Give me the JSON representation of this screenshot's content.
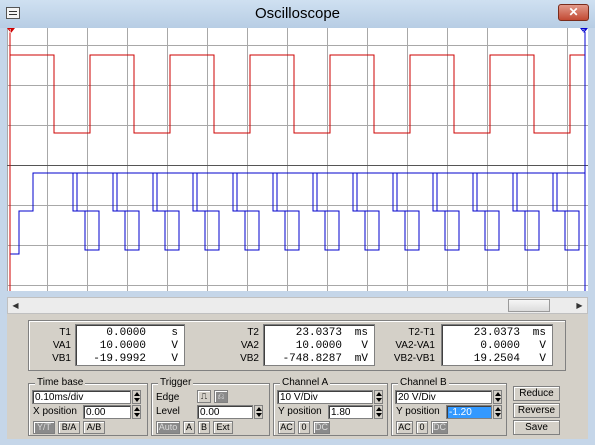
{
  "window": {
    "title": "Oscilloscope"
  },
  "cursors": {
    "t1_marker": "1",
    "t2_marker": "2"
  },
  "scope": {
    "divisions": {
      "x": 14.5,
      "y": 6.575
    },
    "timebase_ms_per_div": 0.1,
    "channel_a": {
      "color": "#cc0000",
      "volts_per_div": 10,
      "period_ms": 0.2,
      "duty": 0.55,
      "high_div": -1.96,
      "low_div": 0.0
    },
    "channel_b": {
      "color": "#0000cc",
      "volts_per_div": 20,
      "period_ms": 0.2,
      "levels_div": [
        0.95,
        -0.95,
        0.7
      ]
    }
  },
  "readouts": {
    "col1": [
      {
        "label": "T1",
        "value": "0.0000",
        "unit": "s"
      },
      {
        "label": "VA1",
        "value": "10.0000",
        "unit": "V"
      },
      {
        "label": "VB1",
        "value": "-19.9992",
        "unit": "V"
      }
    ],
    "col2": [
      {
        "label": "T2",
        "value": "23.0373",
        "unit": "ms"
      },
      {
        "label": "VA2",
        "value": "10.0000",
        "unit": "V"
      },
      {
        "label": "VB2",
        "value": "-748.8287",
        "unit": "mV"
      }
    ],
    "col3": [
      {
        "label": "T2-T1",
        "value": "23.0373",
        "unit": "ms"
      },
      {
        "label": "VA2-VA1",
        "value": "0.0000",
        "unit": "V"
      },
      {
        "label": "VB2-VB1",
        "value": "19.2504",
        "unit": "V"
      }
    ]
  },
  "timebase": {
    "title": "Time base",
    "scale": "0.10ms/div",
    "xpos_label": "X position",
    "xpos": "0.00",
    "modes": [
      "Y/T",
      "B/A",
      "A/B"
    ]
  },
  "trigger": {
    "title": "Trigger",
    "edge_label": "Edge",
    "level_label": "Level",
    "level": "0.00",
    "sources": [
      "Auto",
      "A",
      "B",
      "Ext"
    ]
  },
  "channel_a_ctrl": {
    "title": "Channel A",
    "scale": "10 V/Div",
    "ypos_label": "Y position",
    "ypos": "1.80",
    "coupling": [
      "AC",
      "0",
      "DC"
    ]
  },
  "channel_b_ctrl": {
    "title": "Channel B",
    "scale": "20 V/Div",
    "ypos_label": "Y position",
    "ypos": "-1.20",
    "coupling": [
      "AC",
      "0",
      "DC"
    ]
  },
  "actions": {
    "reduce": "Reduce",
    "reverse": "Reverse",
    "save": "Save"
  }
}
